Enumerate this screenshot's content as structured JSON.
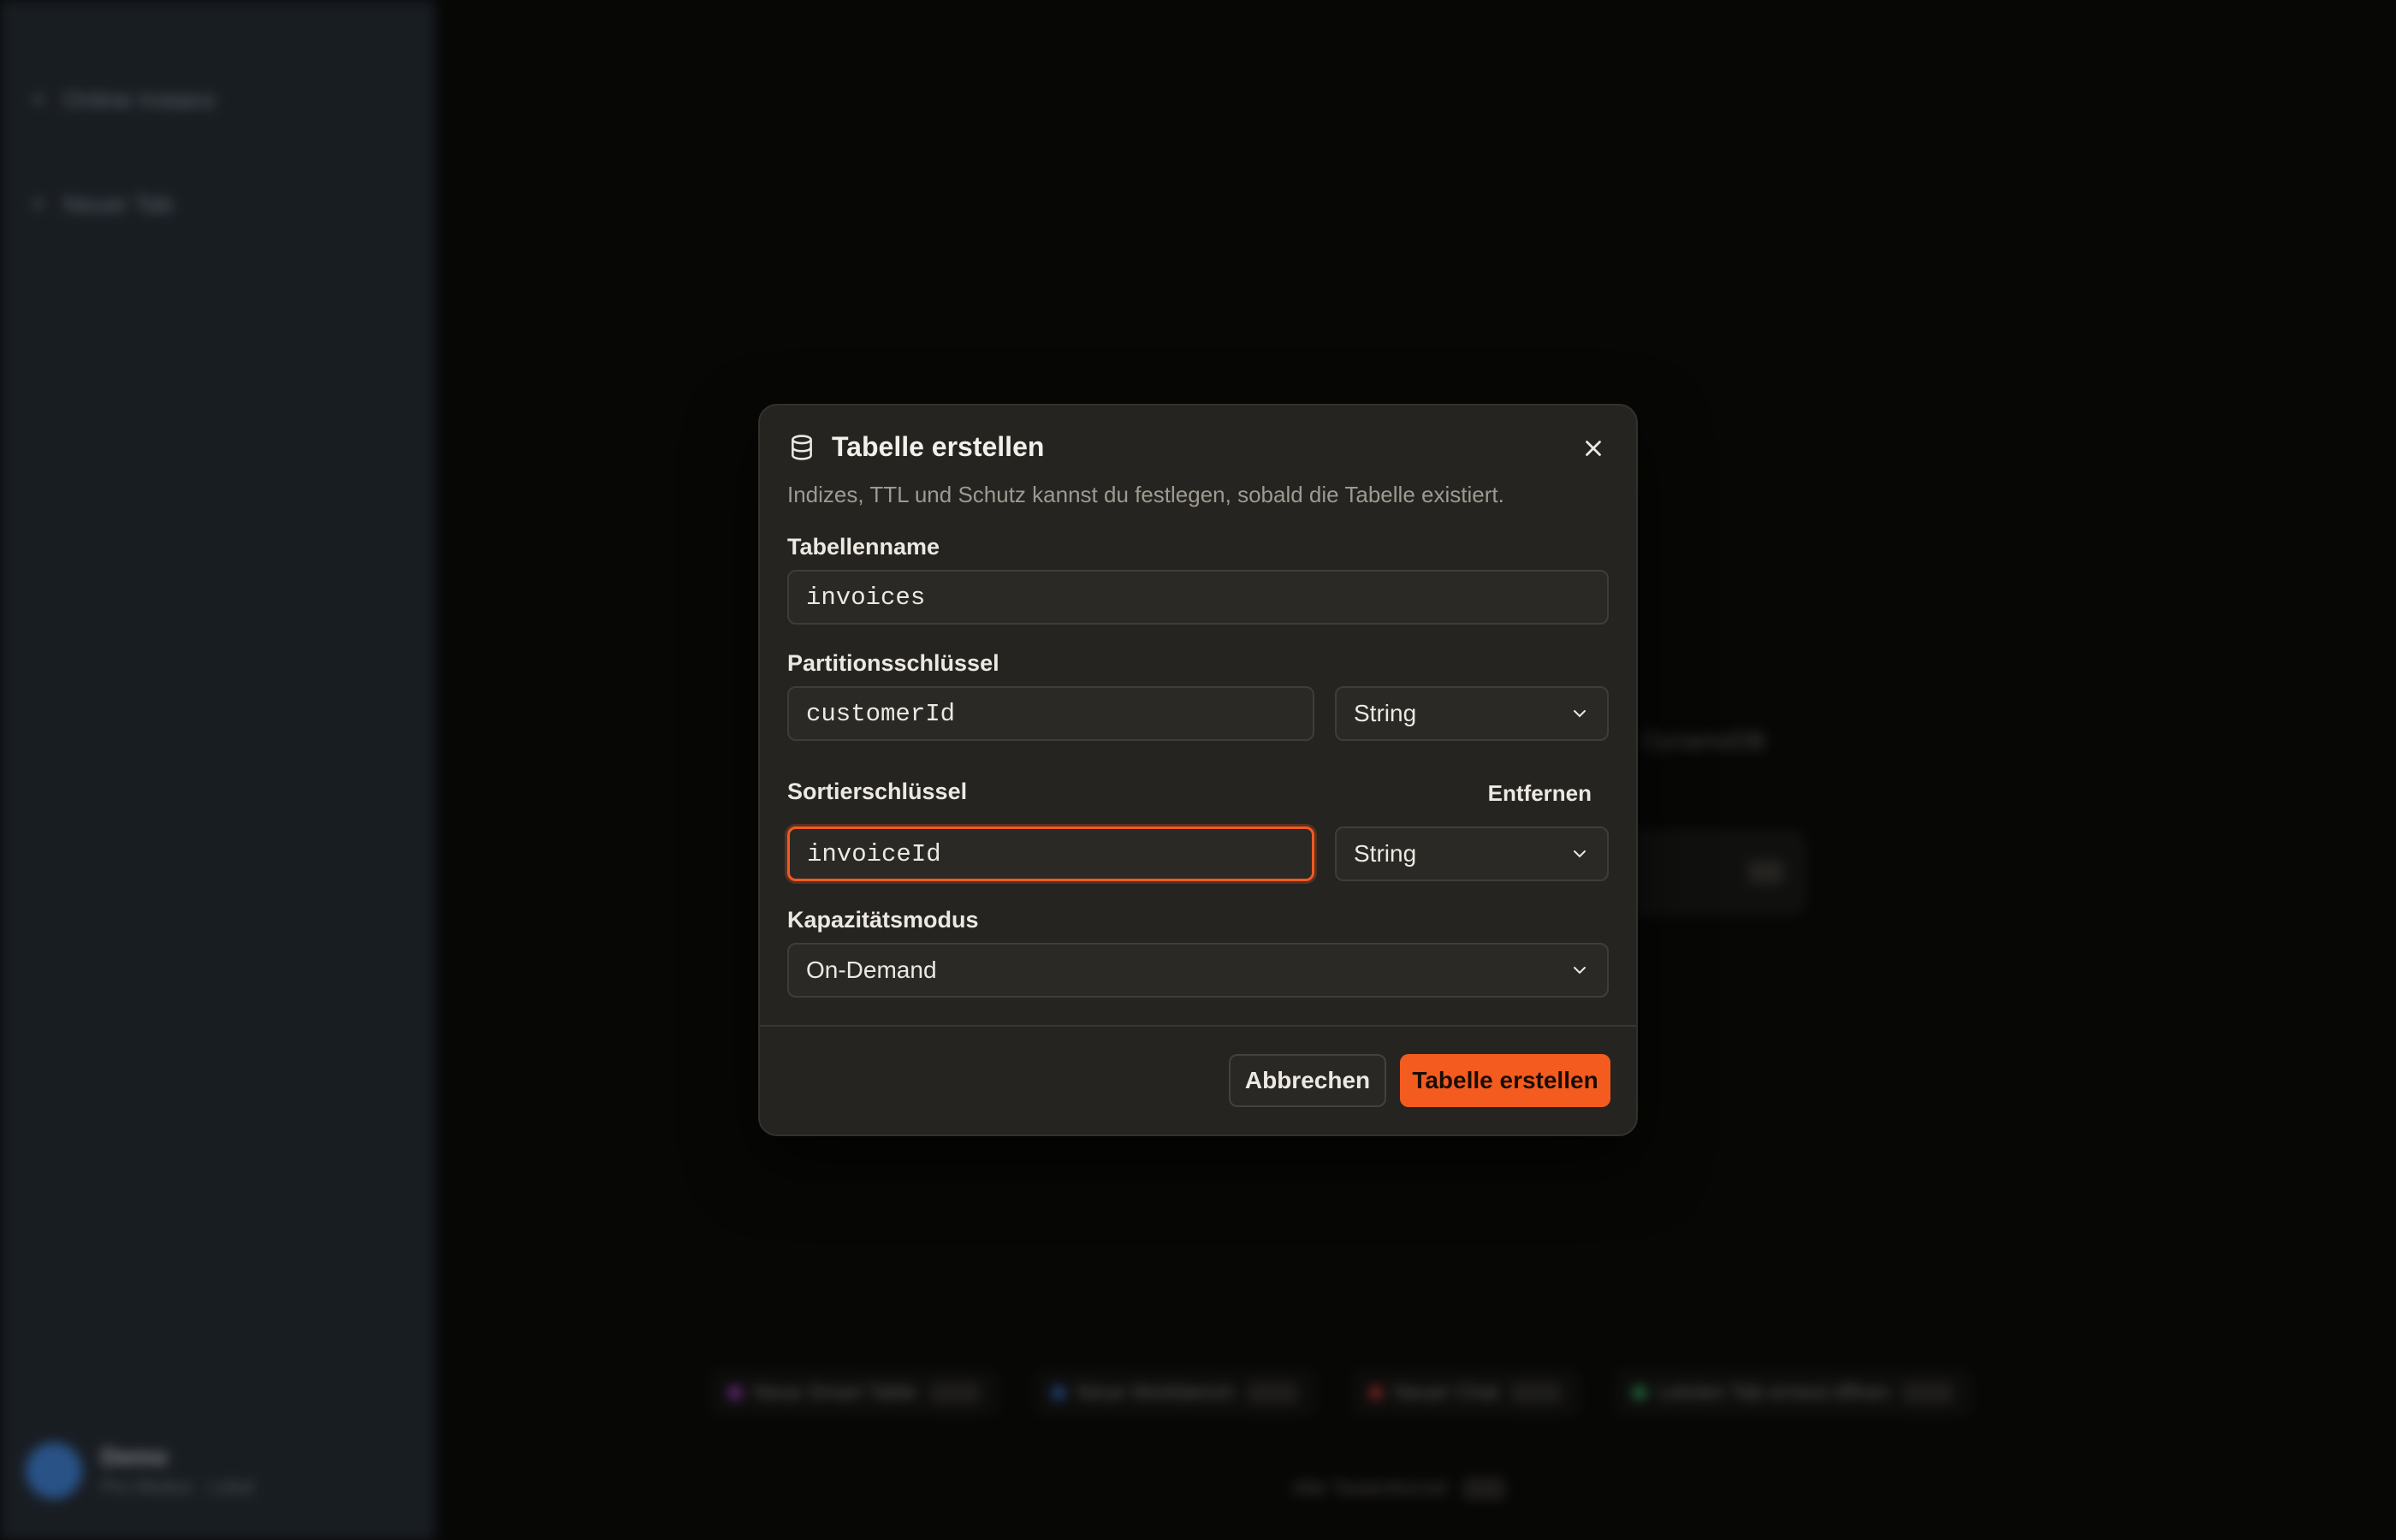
{
  "background": {
    "sidebar": {
      "items": [
        {
          "label": "Online Instanz"
        },
        {
          "label": "Neuer Tab"
        }
      ],
      "user": {
        "name": "Demo",
        "sub": "Pro Modus · Lokal"
      }
    },
    "hint": "DynamoDB",
    "quick_actions": [
      {
        "label": "Neue Smart Table",
        "color": "#b04ad8"
      },
      {
        "label": "Neue Workbench",
        "color": "#3d7ad8"
      },
      {
        "label": "Neuer Chat",
        "color": "#d04040"
      },
      {
        "label": "Letzten Tab erneut öffnen",
        "color": "#3fb86a"
      }
    ],
    "footer_hint": "Alle Tastenkürzel"
  },
  "dialog": {
    "title": "Tabelle erstellen",
    "title_icon": "database-icon",
    "subtitle": "Indizes, TTL und Schutz kannst du festlegen, sobald die Tabelle existiert.",
    "close_icon": "close-icon",
    "table_name": {
      "label": "Tabellenname",
      "value": "invoices"
    },
    "partition_key": {
      "label": "Partitionsschlüssel",
      "value": "customerId",
      "type": "String"
    },
    "sort_key": {
      "label": "Sortierschlüssel",
      "value": "invoiceId",
      "type": "String",
      "remove_label": "Entfernen"
    },
    "capacity_mode": {
      "label": "Kapazitätsmodus",
      "value": "On-Demand"
    },
    "cancel_label": "Abbrechen",
    "submit_label": "Tabelle erstellen",
    "accent_color": "#f45b1f"
  }
}
